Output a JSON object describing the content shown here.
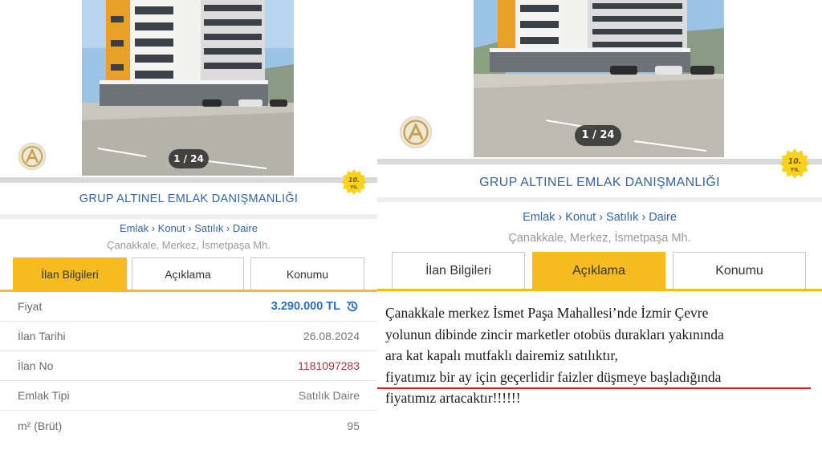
{
  "left": {
    "photo_counter": "1 / 24",
    "office_name": "GRUP ALTINEL EMLAK DANIŞMANLIĞI",
    "badge_years": "10.",
    "badge_word": "YIL",
    "breadcrumb": "Emlak › Konut › Satılık › Daire",
    "location": "Çanakkale, Merkez, İsmetpaşa Mh.",
    "tabs": [
      "İlan Bilgileri",
      "Açıklama",
      "Konumu"
    ],
    "active_tab": 0,
    "info_rows": [
      {
        "label": "Fiyat",
        "value": "3.290.000 TL"
      },
      {
        "label": "İlan Tarihi",
        "value": "26.08.2024"
      },
      {
        "label": "İlan No",
        "value": "1181097283"
      },
      {
        "label": "Emlak Tipi",
        "value": "Satılık Daire"
      },
      {
        "label": "m² (Brüt)",
        "value": "95"
      }
    ]
  },
  "right": {
    "photo_counter": "1 / 24",
    "office_name": "GRUP ALTINEL EMLAK DANIŞMANLIĞI",
    "badge_years": "10.",
    "badge_word": "YIL",
    "breadcrumb": "Emlak › Konut › Satılık › Daire",
    "location": "Çanakkale, Merkez, İsmetpaşa Mh.",
    "tabs": [
      "İlan Bilgileri",
      "Açıklama",
      "Konumu"
    ],
    "active_tab": 1,
    "description_lines": [
      "Çanakkale merkez İsmet Paşa Mahallesi’nde İzmir Çevre",
      "yolunun dibinde zincir marketler otobüs durakları yakınında",
      "ara kat kapalı mutfaklı dairemiz satılıktır,",
      "fiyatımız bir ay için geçerlidir faizler düşmeye başladığında",
      "fiyatımız artacaktır!!!!!!"
    ]
  },
  "colors": {
    "accent_yellow": "#f6bb1e",
    "link_blue": "#3465a4",
    "price_blue": "#2e6fb7",
    "listing_no_red": "#a63535",
    "highlight_underline": "#d91e1e"
  },
  "icons": {
    "brand_logo": "altinel-logo",
    "price_history": "history-icon",
    "anniversary_badge": "10-year-badge"
  }
}
